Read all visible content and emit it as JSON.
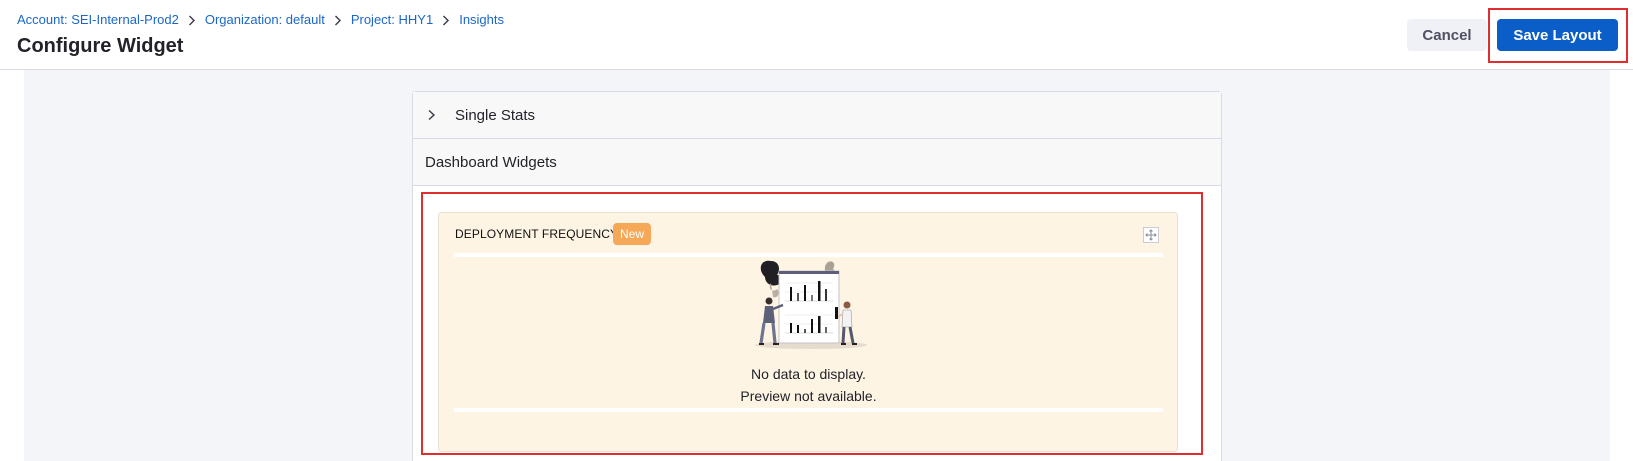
{
  "breadcrumb": [
    {
      "label": "Account: SEI-Internal-Prod2"
    },
    {
      "label": "Organization: default"
    },
    {
      "label": "Project: HHY1"
    },
    {
      "label": "Insights"
    }
  ],
  "page": {
    "title": "Configure Widget"
  },
  "actions": {
    "cancel_label": "Cancel",
    "save_label": "Save Layout"
  },
  "sections": {
    "single_stats": "Single Stats",
    "dashboard_widgets": "Dashboard Widgets"
  },
  "widget": {
    "title": "DEPLOYMENT FREQUENCY",
    "badge": "New",
    "empty_line1": "No data to display.",
    "empty_line2": "Preview not available."
  },
  "colors": {
    "primary": "#0b5ec7",
    "highlight": "#e02d2d",
    "badge": "#f4a858",
    "widget_bg": "#fdf4e3"
  },
  "icons": {
    "crumb_separator": "chevron-right-icon",
    "section_toggle": "chevron-right-icon",
    "widget_expand": "expand-icon"
  }
}
